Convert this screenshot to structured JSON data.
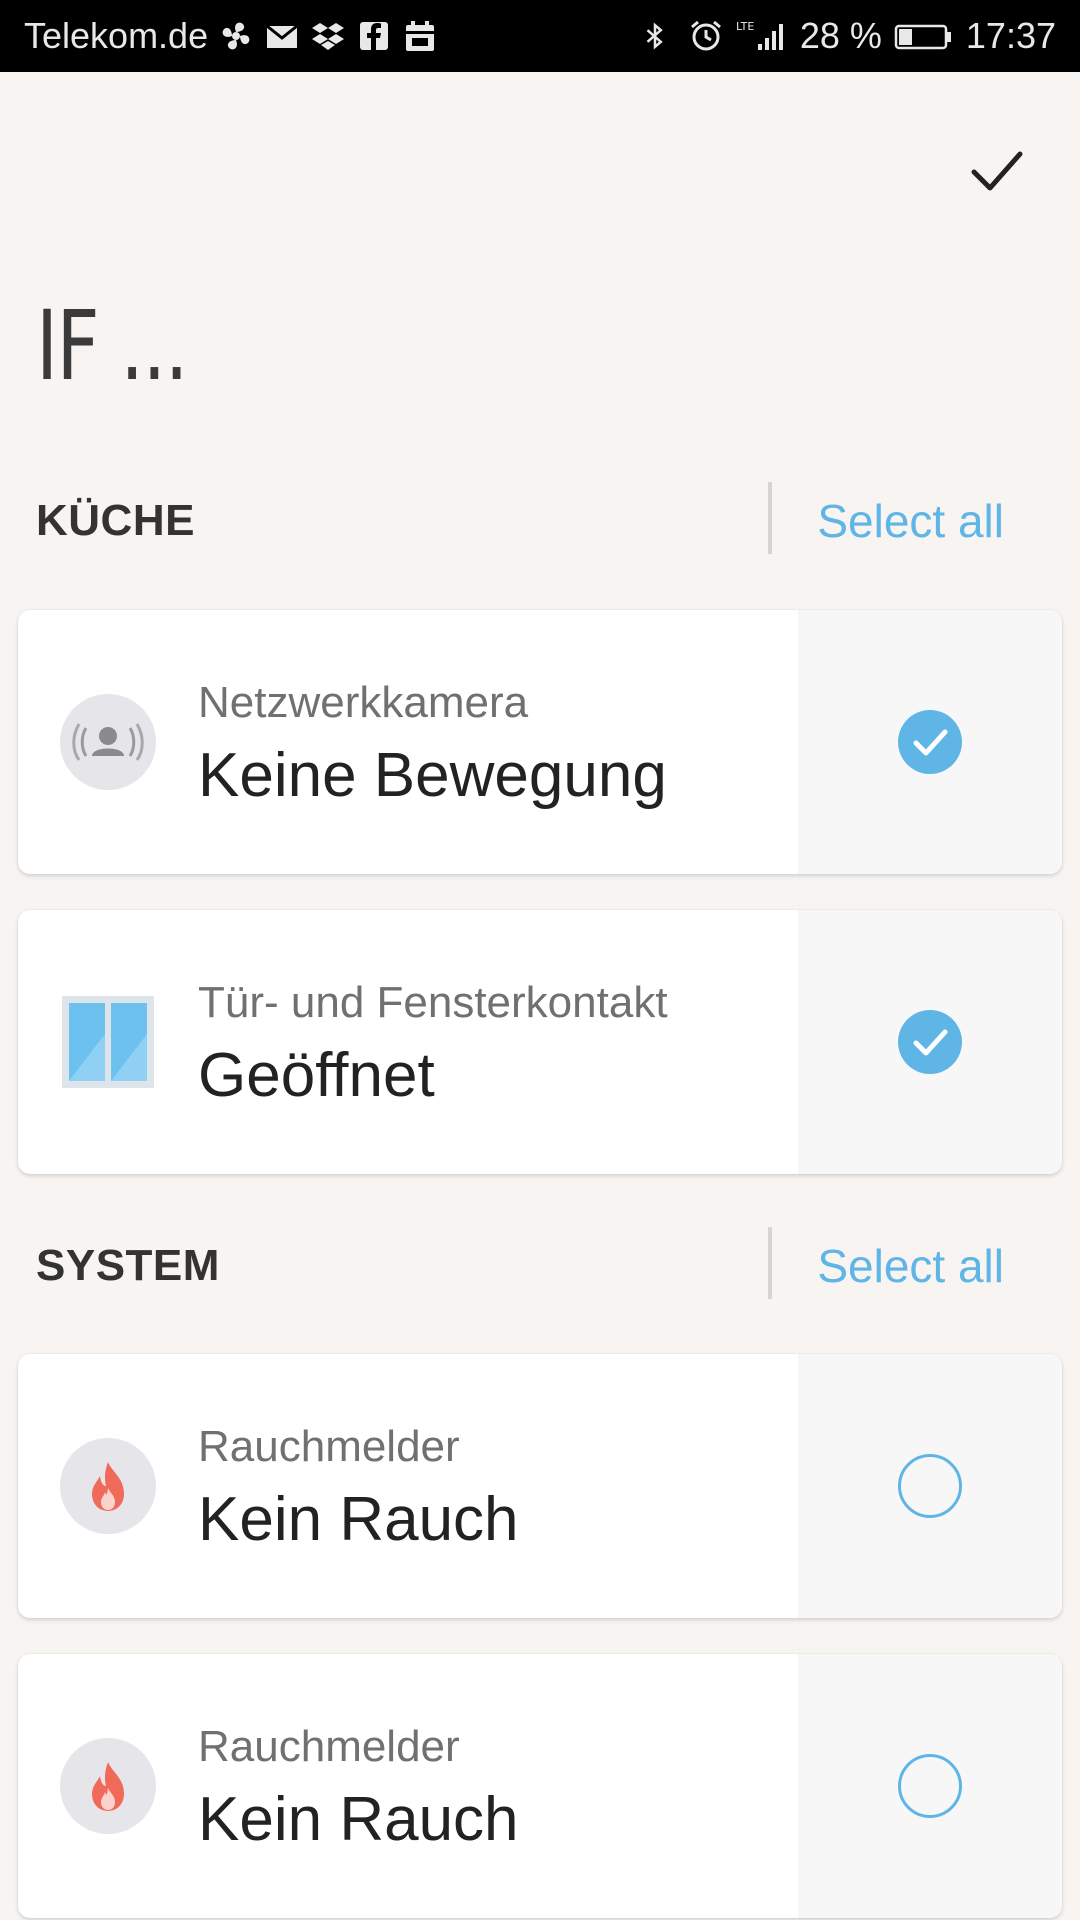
{
  "status_bar": {
    "carrier": "Telekom.de",
    "battery_text": "28 %",
    "time": "17:37",
    "network": "LTE",
    "left_icons": [
      "fan-icon",
      "mail-icon",
      "dropbox-icon",
      "facebook-icon",
      "calendar-icon"
    ],
    "right_icons": [
      "bluetooth-icon",
      "alarm-icon",
      "signal-icon",
      "battery-icon"
    ]
  },
  "toolbar": {
    "confirm_icon": "checkmark-icon"
  },
  "title": "IF ...",
  "colors": {
    "accent": "#5fb5e6",
    "background": "#f7f4f1",
    "flame": "#f06a5a"
  },
  "sections": [
    {
      "title": "KÜCHE",
      "select_all": "Select all",
      "items": [
        {
          "name": "Netzwerkkamera",
          "state": "Keine Bewegung",
          "icon": "camera-motion-icon",
          "selected": true
        },
        {
          "name": "Tür- und Fensterkontakt",
          "state": "Geöffnet",
          "icon": "window-icon",
          "selected": true
        }
      ]
    },
    {
      "title": "SYSTEM",
      "select_all": "Select all",
      "items": [
        {
          "name": "Rauchmelder",
          "state": "Kein Rauch",
          "icon": "flame-icon",
          "selected": false
        },
        {
          "name": "Rauchmelder",
          "state": "Kein Rauch",
          "icon": "flame-icon",
          "selected": false
        }
      ]
    }
  ]
}
